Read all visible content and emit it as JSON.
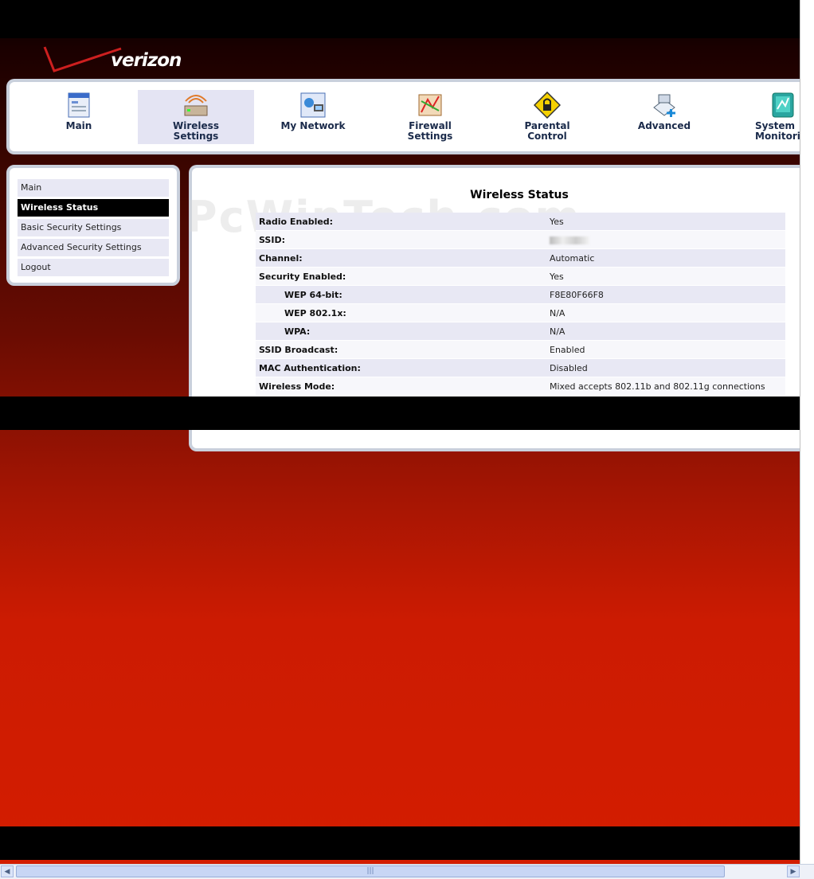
{
  "brand": {
    "name": "verizon",
    "watermark": "PcWinTech.com"
  },
  "nav": [
    {
      "label": "Main",
      "icon": "main-page-icon"
    },
    {
      "label": "Wireless\nSettings",
      "icon": "wireless-router-icon",
      "active": true
    },
    {
      "label": "My Network",
      "icon": "network-computers-icon"
    },
    {
      "label": "Firewall\nSettings",
      "icon": "firewall-icon"
    },
    {
      "label": "Parental\nControl",
      "icon": "lock-warning-icon"
    },
    {
      "label": "Advanced",
      "icon": "advanced-tools-icon"
    },
    {
      "label": "System\nMonitoring",
      "icon": "system-monitor-icon"
    }
  ],
  "sidebar": {
    "items": [
      {
        "label": "Main"
      },
      {
        "label": "Wireless Status",
        "active": true
      },
      {
        "label": "Basic Security Settings"
      },
      {
        "label": "Advanced Security Settings"
      },
      {
        "label": "Logout"
      }
    ]
  },
  "status": {
    "title": "Wireless Status",
    "rows": [
      {
        "label": "Radio Enabled:",
        "value": "Yes"
      },
      {
        "label": "SSID:",
        "value": ""
      },
      {
        "label": "Channel:",
        "value": "Automatic"
      },
      {
        "label": "Security Enabled:",
        "value": "Yes"
      },
      {
        "label": "WEP 64-bit:",
        "value": "F8E80F66F8"
      },
      {
        "label": "WEP 802.1x:",
        "value": "N/A"
      },
      {
        "label": "WPA:",
        "value": "N/A"
      },
      {
        "label": "SSID Broadcast:",
        "value": "Enabled"
      },
      {
        "label": "MAC Authentication:",
        "value": "Disabled"
      },
      {
        "label": "Wireless Mode:",
        "value": "Mixed accepts 802.11b and 802.11g connections"
      }
    ]
  },
  "colors": {
    "brand_red": "#cd1f1f",
    "active_tab_bg": "#e4e4f3",
    "sidebar_active_bg": "#000000",
    "panel_border": "#c9d0dc"
  }
}
